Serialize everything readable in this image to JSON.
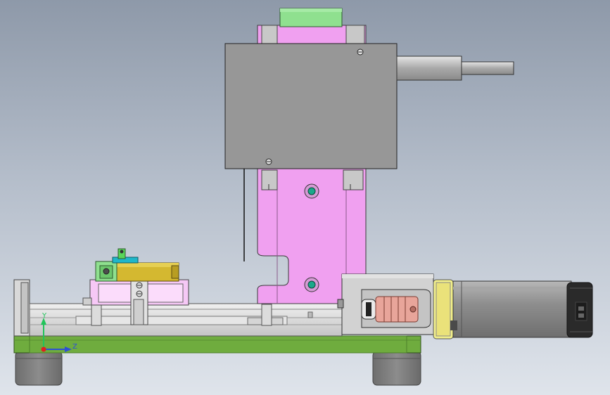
{
  "view": {
    "background_top": "#8e99a9",
    "background_bottom": "#dfe4eb"
  },
  "triad": {
    "y_label": "Y",
    "z_label": "Z",
    "y_color": "#21c45a",
    "z_color": "#2d4fd6",
    "x_color": "#e02020"
  },
  "colors": {
    "housing_gray": "#979797",
    "column_pink": "#f0a0f0",
    "base_green": "#6fac3e",
    "motor_body": "#8c8c8c",
    "motor_end": "#2a2a2a",
    "flange_yellow": "#f3f08a",
    "clamp_gold": "#d4b830",
    "top_green": "#8fe08f",
    "coupling_copper": "#e8a59a"
  }
}
